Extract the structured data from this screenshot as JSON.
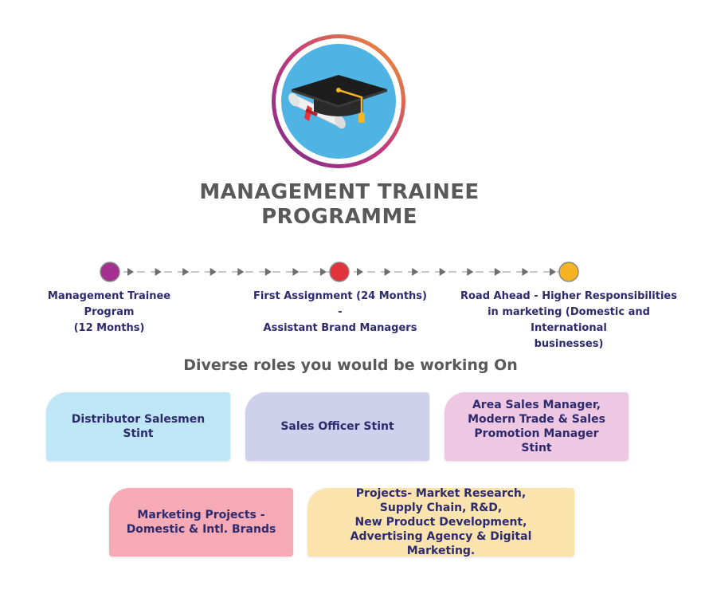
{
  "title_line1": "MANAGEMENT TRAINEE",
  "title_line2": "PROGRAMME",
  "colors": {
    "milestone_1": "#a3308f",
    "milestone_2": "#e2333c",
    "milestone_3": "#f6b323",
    "text_dark": "#2d2a6e",
    "heading": "#595959"
  },
  "icons": [
    "graduation-cap-icon",
    "diploma-scroll-icon"
  ],
  "milestones": [
    {
      "line1": "Management Trainee Program",
      "line2": "(12 Months)"
    },
    {
      "line1": "First Assignment (24 Months) -",
      "line2": "Assistant Brand Managers"
    },
    {
      "line1": "Road Ahead - Higher Responsibilities",
      "line2": "in marketing (Domestic and International",
      "line3": "businesses)"
    }
  ],
  "subtitle": "Diverse roles you would be working On",
  "roles": [
    {
      "lines": [
        "Distributor Salesmen",
        "Stint"
      ]
    },
    {
      "lines": [
        "Sales Officer Stint"
      ]
    },
    {
      "lines": [
        "Area Sales Manager,",
        "Modern Trade & Sales",
        "Promotion Manager Stint"
      ]
    },
    {
      "lines": [
        "Marketing Projects -",
        "Domestic & Intl. Brands"
      ]
    },
    {
      "lines": [
        "Projects- Market Research,",
        "Supply Chain, R&D,",
        "New Product Development,",
        "Advertising Agency & Digital Marketing."
      ]
    }
  ]
}
